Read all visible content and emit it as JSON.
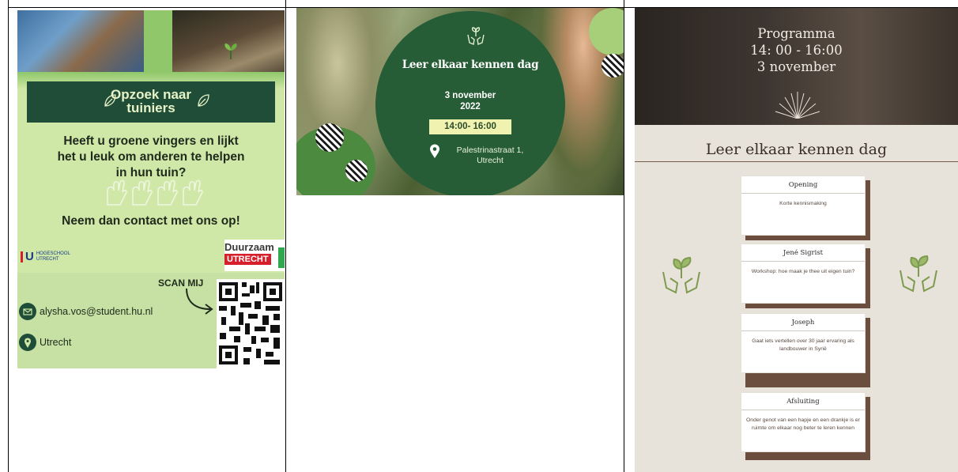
{
  "flyer": {
    "banner_title_line1": "Opzoek naar",
    "banner_title_line2": "tuiniers",
    "question_line1": "Heeft u groene vingers en lijkt",
    "question_line2": "het u leuk om anderen te helpen",
    "question_line3": "in hun tuin?",
    "call_to_action": "Neem dan contact met ons op!",
    "logo_left_letter": "U",
    "logo_left_text_1": "HOGESCHOOL",
    "logo_left_text_2": "UTRECHT",
    "logo_right_text_1": "Duurzaam",
    "logo_right_text_2": "UTRECHT",
    "scan_label": "SCAN MIJ",
    "email": "alysha.vos@student.hu.nl",
    "city": "Utrecht",
    "accent_green": "#1f4d38",
    "background_green": "#cfe7a7"
  },
  "invitation": {
    "title": "Leer elkaar kennen dag",
    "date_line1": "3 november",
    "date_line2": "2022",
    "time": "14:00- 16:00",
    "address_line1": "Palestrinastraat 1,",
    "address_line2": "Utrecht",
    "oval_color": "#265c36",
    "time_bg": "#f0f2b0"
  },
  "program": {
    "header_line1": "Programma",
    "header_line2": "14: 00 - 16:00",
    "header_line3": "3 november",
    "title": "Leer elkaar kennen dag",
    "items": [
      {
        "name": "Opening",
        "desc": "Korte kennismaking"
      },
      {
        "name": "Jené Sigrist",
        "desc": "Workshop: hoe maak je thee uit eigen tuin?"
      },
      {
        "name": "Joseph",
        "desc": "Gaat iets vertellen over 30 jaar ervaring als landbouwer in Syrië"
      },
      {
        "name": "Afsluiting",
        "desc": "Onder genot van een hapje en een drankje is er ruimte om elkaar nog beter te leren kennen"
      }
    ],
    "card_shadow_color": "#6b4e3e",
    "background": "#e8e3da"
  }
}
